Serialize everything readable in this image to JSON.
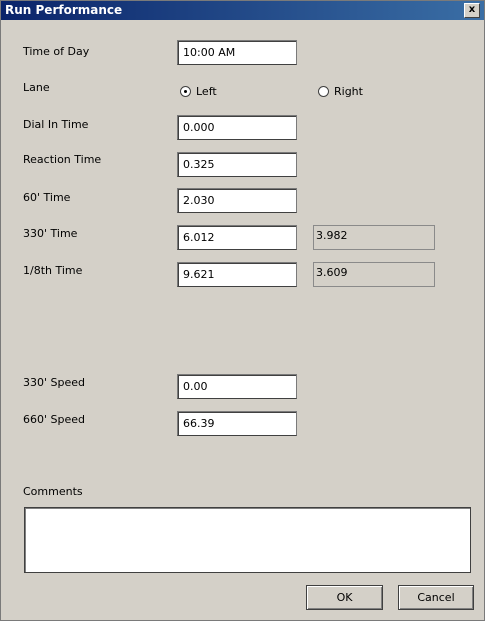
{
  "window": {
    "title": "Run Performance",
    "close_label": "x"
  },
  "fields": {
    "time_of_day": {
      "label": "Time of Day",
      "value": "10:00 AM"
    },
    "lane": {
      "label": "Lane",
      "options": [
        "Left",
        "Right"
      ],
      "selected": "Left"
    },
    "dial_in_time": {
      "label": "Dial In Time",
      "value": "0.000"
    },
    "reaction_time": {
      "label": "Reaction Time",
      "value": "0.325"
    },
    "sixty_time": {
      "label": "60' Time",
      "value": "2.030"
    },
    "t330_time": {
      "label": "330' Time",
      "value": "6.012",
      "split": "3.982"
    },
    "eighth_time": {
      "label": "1/8th Time",
      "value": "9.621",
      "split": "3.609"
    },
    "speed_330": {
      "label": "330' Speed",
      "value": "0.00"
    },
    "speed_660": {
      "label": "660' Speed",
      "value": "66.39"
    },
    "comments": {
      "label": "Comments",
      "value": ""
    }
  },
  "buttons": {
    "ok": "OK",
    "cancel": "Cancel"
  },
  "colors": {
    "dialog_bg": "#d4d0c8",
    "titlebar_start": "#0a246a",
    "titlebar_end": "#3a6ea5"
  }
}
